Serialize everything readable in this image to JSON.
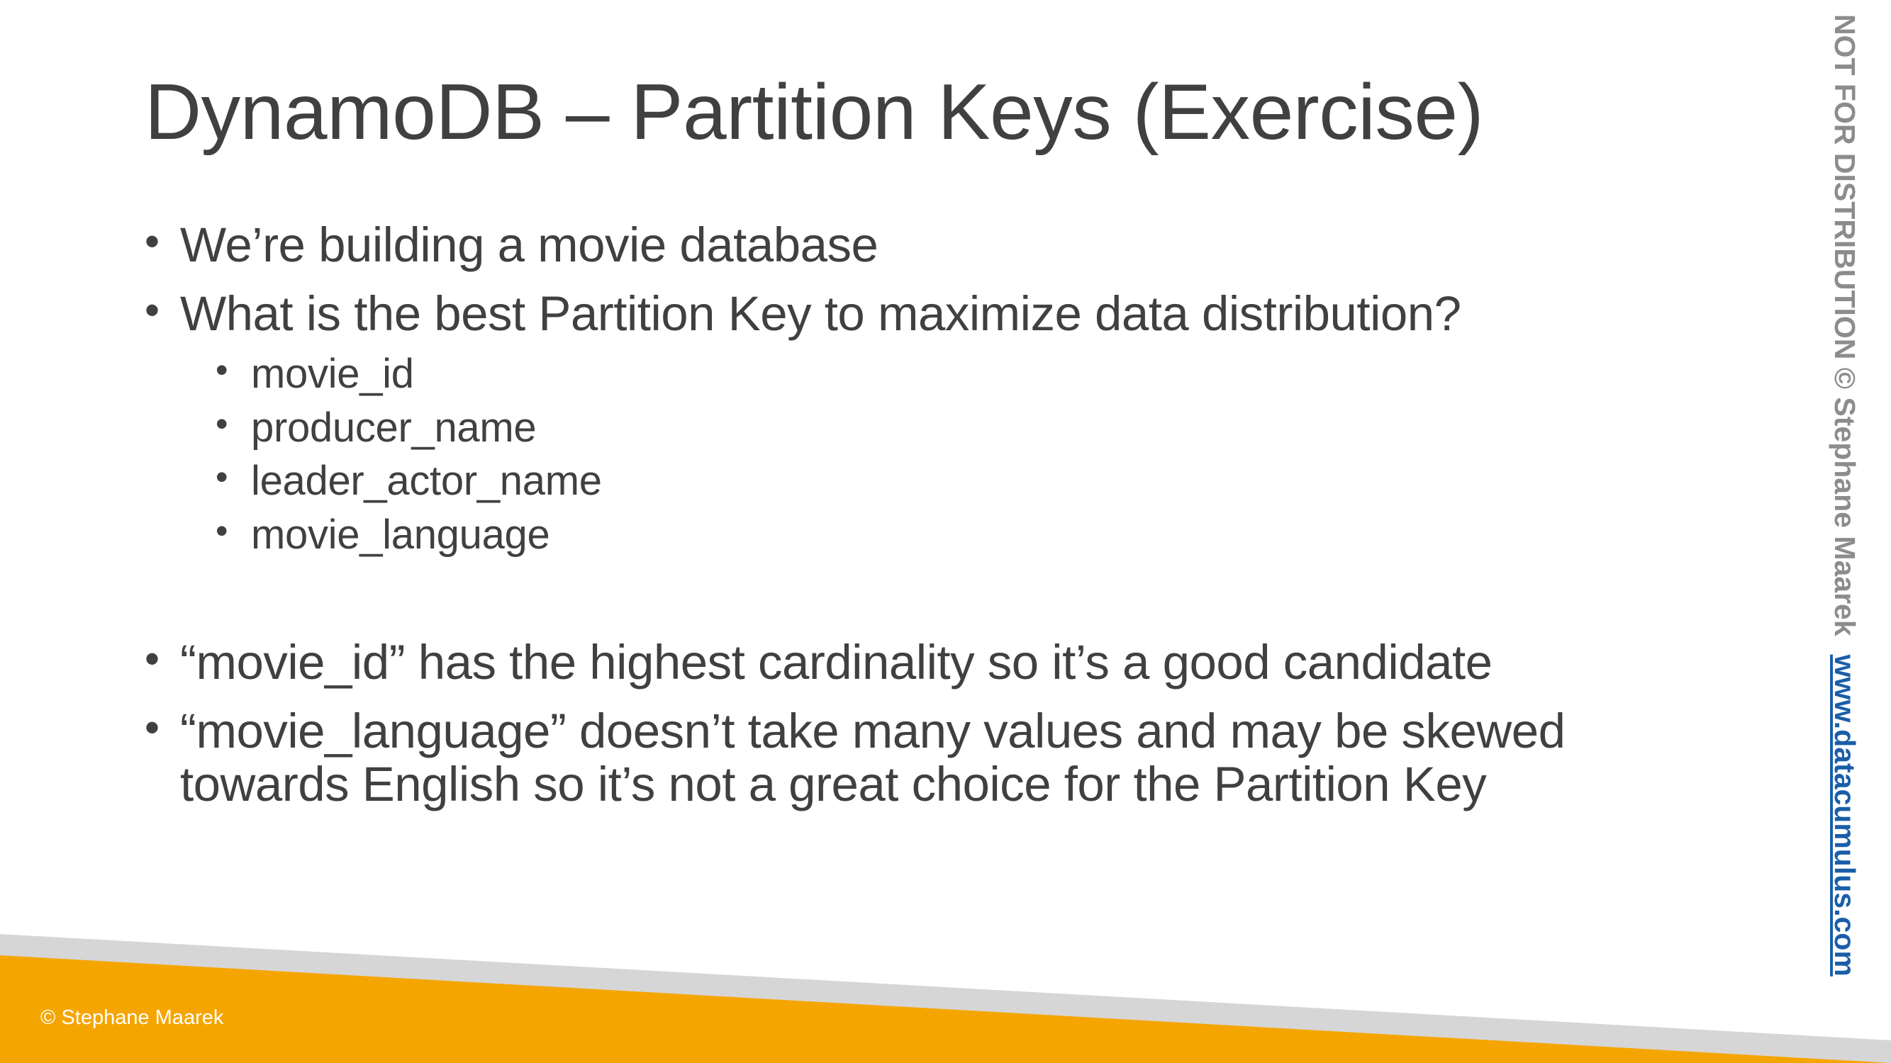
{
  "title": "DynamoDB – Partition Keys (Exercise)",
  "bullets": [
    "We’re building a movie database",
    "What is the best Partition Key to maximize data distribution?",
    "“movie_id” has the highest cardinality so it’s a good candidate",
    "“movie_language” doesn’t take many values and may be skewed towards English so it’s not a great choice for the Partition Key"
  ],
  "sub_bullets": [
    "movie_id",
    "producer_name",
    "leader_actor_name",
    "movie_language"
  ],
  "bullet_glyph": "•",
  "footer": "© Stephane Maarek",
  "side_notice": "NOT FOR DISTRIBUTION © Stephane Maarek",
  "side_link": "www.datacumulus.com",
  "colors": {
    "text": "#404040",
    "footer_band": "#f5a500",
    "footer_shadow": "#d6d6d6",
    "side_notice": "#8c8c8c",
    "link": "#1a5ea8"
  }
}
